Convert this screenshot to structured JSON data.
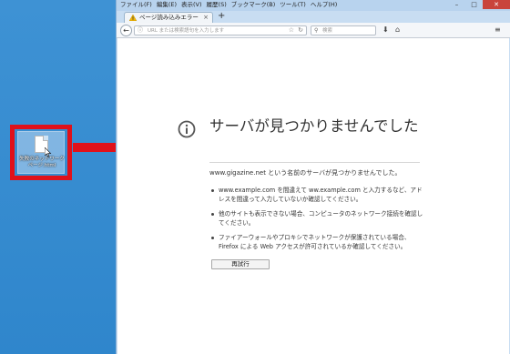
{
  "desktop": {
    "icon_label": "失敗のネットワークページ.html",
    "highlight_color": "#e0111a"
  },
  "browser": {
    "menu": [
      "ファイル(F)",
      "編集(E)",
      "表示(V)",
      "履歴(S)",
      "ブックマーク(B)",
      "ツール(T)",
      "ヘルプ(H)"
    ],
    "window_controls": {
      "minimize": "–",
      "maximize": "□",
      "close": "✕"
    },
    "tab": {
      "title": "ページ読み込みエラー",
      "close": "×"
    },
    "new_tab": "+",
    "nav": {
      "back": "←",
      "url_placeholder": "URL または検索語句を入力します",
      "search_placeholder": "検索",
      "icons": [
        "lock-icon",
        "star-icon",
        "reload-icon",
        "search-icon",
        "download-icon",
        "home-icon",
        "menu-icon"
      ]
    }
  },
  "error_page": {
    "title": "サーバが見つかりませんでした",
    "description": "www.gigazine.net という名前のサーバが見つかりませんでした。",
    "bullets": [
      "www.example.com を間違えて ww.example.com と入力するなど、アドレスを間違って入力していないか確認してください。",
      "他のサイトも表示できない場合、コンピュータのネットワーク接続を確認してください。",
      "ファイアーウォールやプロキシでネットワークが保護されている場合、Firefox による Web アクセスが許可されているか確認してください。"
    ],
    "retry_label": "再試行"
  },
  "colors": {
    "accent_red": "#e0111a",
    "desktop_blue": "#3b8fd1",
    "window_frame": "#c8ddf2"
  }
}
